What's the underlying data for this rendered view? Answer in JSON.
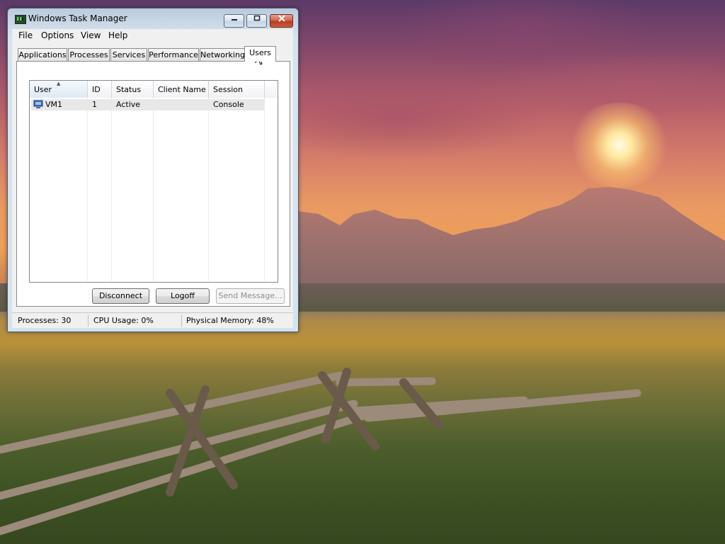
{
  "window": {
    "title": "Windows Task Manager",
    "controls": {
      "minimize_icon": "minimize-icon",
      "maximize_icon": "maximize-icon",
      "close_icon": "close-icon"
    }
  },
  "menu": [
    "File",
    "Options",
    "View",
    "Help"
  ],
  "tabs": [
    {
      "label": "Applications",
      "active": false
    },
    {
      "label": "Processes",
      "active": false
    },
    {
      "label": "Services",
      "active": false
    },
    {
      "label": "Performance",
      "active": false
    },
    {
      "label": "Networking",
      "active": false
    },
    {
      "label": "Users",
      "active": true
    }
  ],
  "users_table": {
    "columns": [
      "User",
      "ID",
      "Status",
      "Client Name",
      "Session"
    ],
    "sorted_column": "User",
    "rows": [
      {
        "user": "VM1",
        "id": "1",
        "status": "Active",
        "client_name": "",
        "session": "Console",
        "icon": "user-icon"
      }
    ]
  },
  "buttons": {
    "disconnect": "Disconnect",
    "logoff": "Logoff",
    "send_message": "Send Message..."
  },
  "status_bar": {
    "processes": "Processes: 30",
    "cpu": "CPU Usage: 0%",
    "memory": "Physical Memory: 48%"
  },
  "colors": {
    "selection_row": "#e8e8e8",
    "close_button": "#c84a30",
    "title_bar": "#bfd3e6"
  }
}
